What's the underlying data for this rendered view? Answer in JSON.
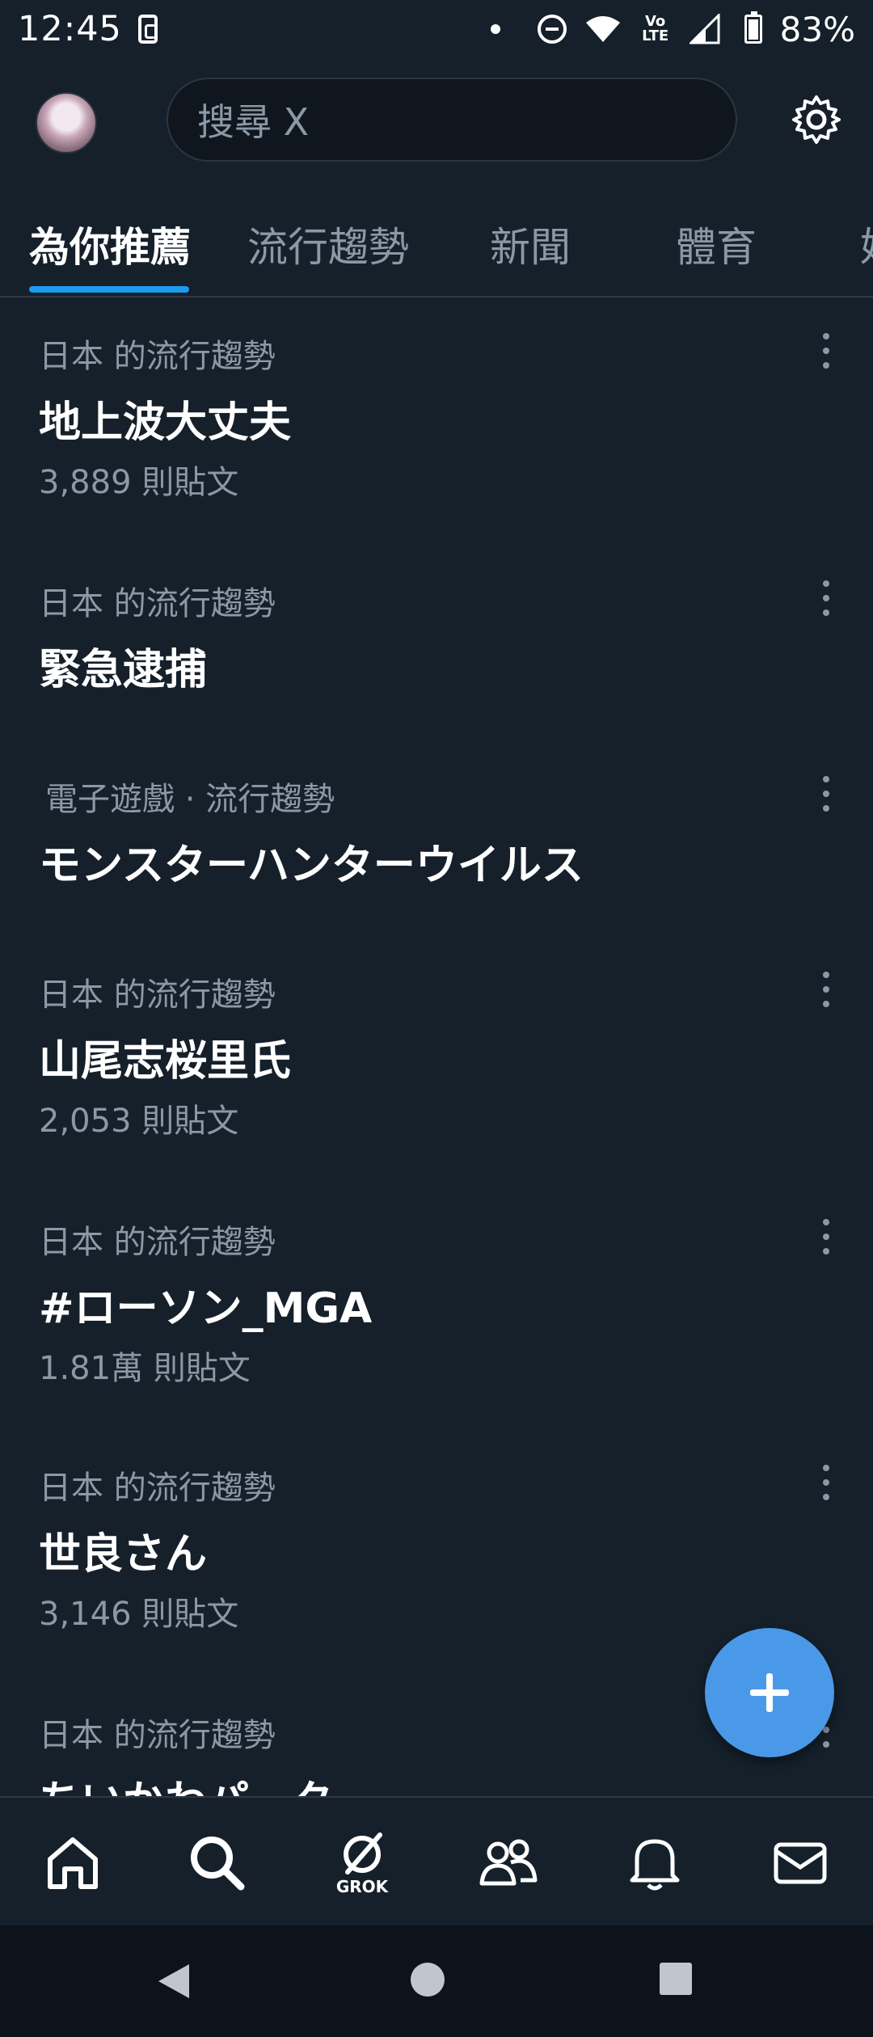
{
  "status_bar": {
    "time": "12:45",
    "battery": "83%",
    "network_label": "Vo LTE"
  },
  "header": {
    "search_placeholder": "搜尋 X"
  },
  "tabs": [
    {
      "label": "為你推薦",
      "active": true
    },
    {
      "label": "流行趨勢",
      "active": false
    },
    {
      "label": "新聞",
      "active": false
    },
    {
      "label": "體育",
      "active": false
    },
    {
      "label": "娛",
      "active": false
    }
  ],
  "trends": [
    {
      "meta": "日本 的流行趨勢",
      "title": "地上波大丈夫",
      "count": "3,889 則貼文"
    },
    {
      "meta": "日本 的流行趨勢",
      "title": "緊急逮捕",
      "count": ""
    },
    {
      "meta": "電子遊戲 · 流行趨勢",
      "title": "モンスターハンターウイルス",
      "count": ""
    },
    {
      "meta": "日本 的流行趨勢",
      "title": "山尾志桜里氏",
      "count": "2,053 則貼文"
    },
    {
      "meta": "日本 的流行趨勢",
      "title": "#ローソン_MGA",
      "count": "1.81萬 則貼文"
    },
    {
      "meta": "日本 的流行趨勢",
      "title": "世良さん",
      "count": "3,146 則貼文"
    },
    {
      "meta": "日本 的流行趨勢",
      "title": "ちいかわパーク",
      "count": ""
    }
  ],
  "bottom_nav": {
    "grok_label": "GROK",
    "items": [
      "home-icon",
      "search-icon",
      "grok-icon",
      "communities-icon",
      "notifications-icon",
      "messages-icon"
    ]
  },
  "colors": {
    "background": "#15202b",
    "accent": "#1d9bf0",
    "fab": "#4a99e9",
    "secondary_text": "#8b98a5"
  }
}
